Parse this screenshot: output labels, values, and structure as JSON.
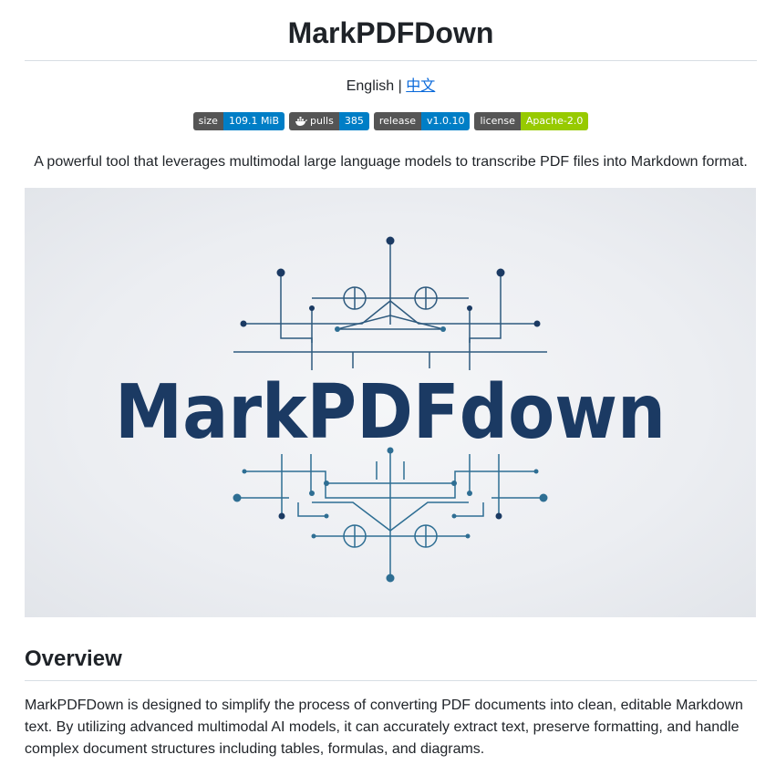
{
  "header": {
    "title": "MarkPDFDown",
    "lang_english": "English |",
    "lang_chinese": "中文"
  },
  "badges": [
    {
      "label": "size",
      "value": "109.1 MiB",
      "color": "#007ec6",
      "icon": ""
    },
    {
      "label": "pulls",
      "value": "385",
      "color": "#007ec6",
      "icon": "docker-icon"
    },
    {
      "label": "release",
      "value": "v1.0.10",
      "color": "#007ec6",
      "icon": ""
    },
    {
      "label": "license",
      "value": "Apache-2.0",
      "color": "#97ca00",
      "icon": ""
    }
  ],
  "description": "A powerful tool that leverages multimodal large language models to transcribe PDF files into Markdown format.",
  "logo": {
    "text": "MarkPDFdown",
    "text_color": "#1b3a63",
    "line_color": "#2e6e93"
  },
  "overview": {
    "heading": "Overview",
    "paragraph": "MarkPDFDown is designed to simplify the process of converting PDF documents into clean, editable Markdown text. By utilizing advanced multimodal AI models, it can accurately extract text, preserve formatting, and handle complex document structures including tables, formulas, and diagrams."
  }
}
